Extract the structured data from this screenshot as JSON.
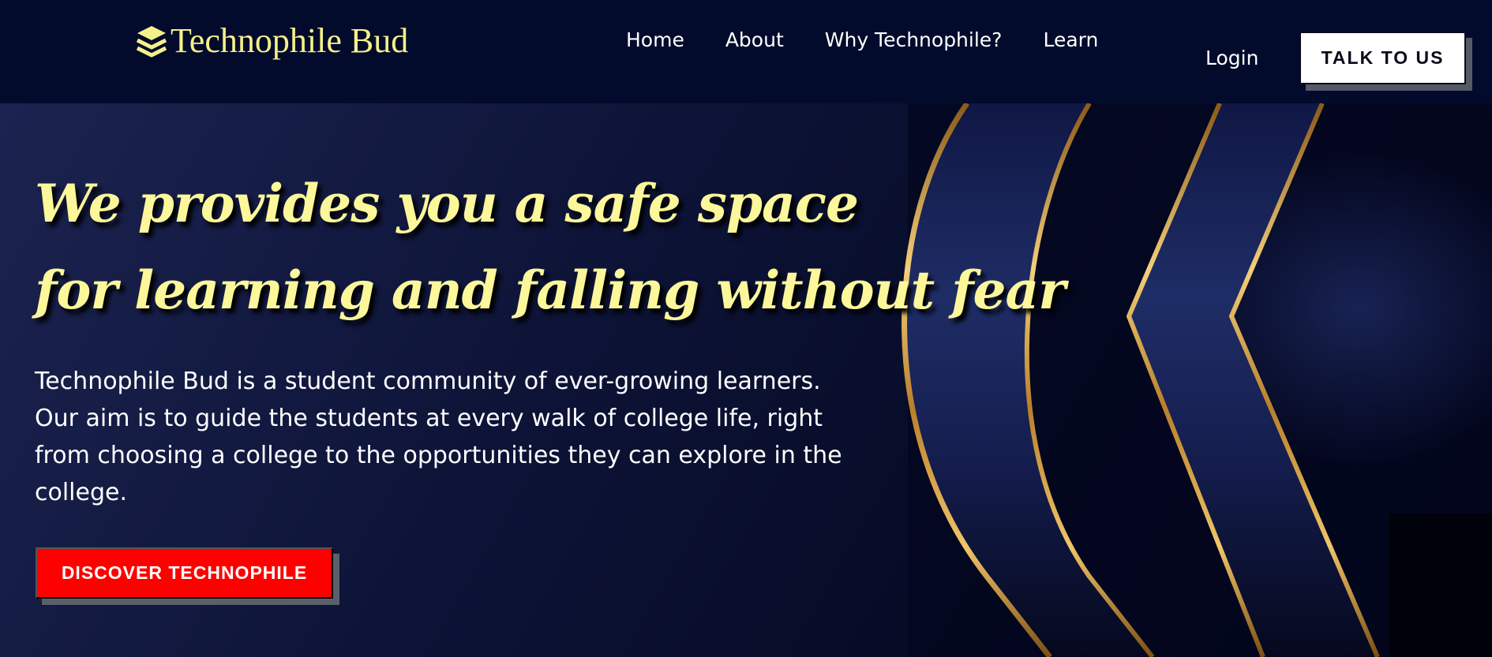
{
  "header": {
    "brand_name": "Technophile Bud",
    "brand_icon": "layers-icon",
    "nav": [
      {
        "label": "Home"
      },
      {
        "label": "About"
      },
      {
        "label": "Why Technophile?"
      },
      {
        "label": "Learn"
      }
    ],
    "login_label": "Login",
    "cta_label": "TALK TO US"
  },
  "hero": {
    "headline_line1": "We provides you a safe space",
    "headline_line2": "for learning and falling without fear",
    "description": "Technophile Bud is a student community of ever-growing learners. Our aim is to guide the students at every walk of college life, right from choosing a college to the opportunities they can explore in the college.",
    "cta_label": "DISCOVER TECHNOPHILE"
  },
  "colors": {
    "brand_yellow": "#f5f08a",
    "navbar_bg": "#020b2b",
    "cta_red": "#ff0000",
    "gold": "#d9a441"
  }
}
